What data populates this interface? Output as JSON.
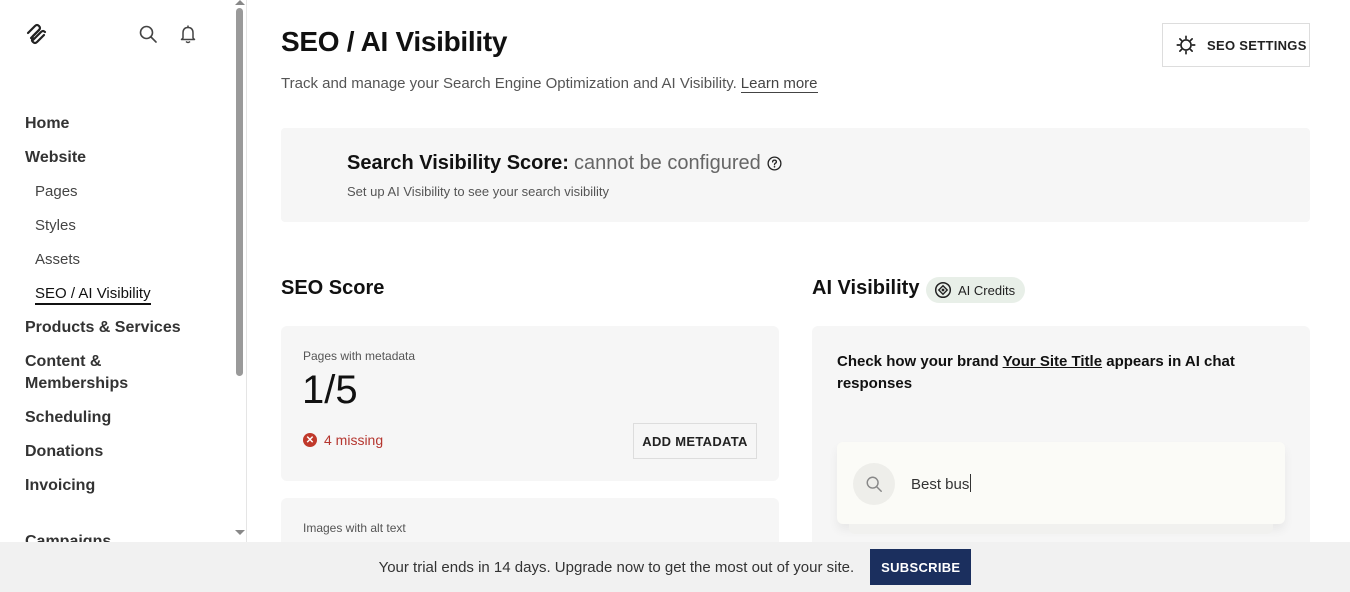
{
  "sidebar": {
    "logo_icon": "squarespace-logo-icon",
    "search_icon": "search-icon",
    "bell_icon": "bell-icon",
    "items": [
      {
        "label": "Home",
        "level": 1
      },
      {
        "label": "Website",
        "level": 1
      },
      {
        "label": "Pages",
        "level": 2
      },
      {
        "label": "Styles",
        "level": 2
      },
      {
        "label": "Assets",
        "level": 2
      },
      {
        "label": "SEO / AI Visibility",
        "level": 2,
        "active": true
      },
      {
        "label": "Products & Services",
        "level": 1
      },
      {
        "label": "Content & Memberships",
        "level": 1
      },
      {
        "label": "Scheduling",
        "level": 1
      },
      {
        "label": "Donations",
        "level": 1
      },
      {
        "label": "Invoicing",
        "level": 1
      },
      {
        "label": "Campaigns",
        "level": 1
      }
    ]
  },
  "header": {
    "title": "SEO / AI Visibility",
    "subtitle": "Track and manage your Search Engine Optimization and AI Visibility.",
    "learn_more": "Learn more",
    "settings_label": "SEO SETTINGS"
  },
  "search_score": {
    "title": "Search Visibility Score:",
    "value": "cannot be configured",
    "subtitle": "Set up AI Visibility to see your search visibility"
  },
  "seo_score": {
    "title": "SEO Score",
    "metadata_label": "Pages with metadata",
    "metadata_value": "1/5",
    "missing": "4 missing",
    "add_button": "ADD METADATA",
    "alt_label": "Images with alt text"
  },
  "ai_visibility": {
    "title": "AI Visibility",
    "credits_label": "AI Credits",
    "text_before": "Check how your brand ",
    "site_title": "Your Site Title",
    "text_after": " appears in AI chat responses",
    "search_text": "Best bus"
  },
  "trial": {
    "text": "Your trial ends in 14 days. Upgrade now to get the most out of your site.",
    "button": "SUBSCRIBE"
  },
  "colors": {
    "accent": "#1b2f5e",
    "error": "#b5362f",
    "card_bg": "#f6f6f6"
  }
}
